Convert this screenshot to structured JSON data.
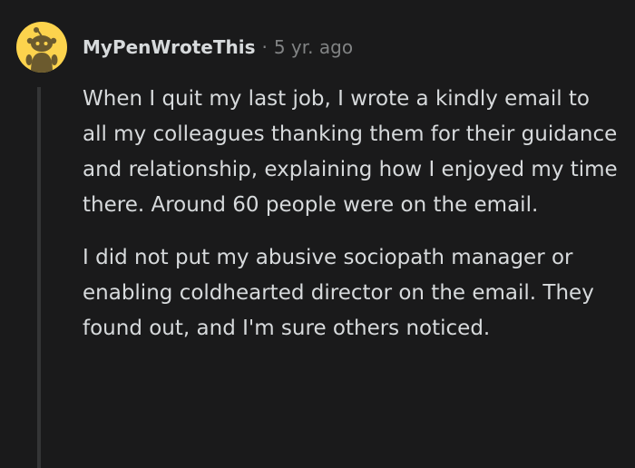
{
  "comment": {
    "author": "MyPenWroteThis",
    "separator": "·",
    "timestamp": "5 yr. ago",
    "paragraphs": [
      "When I quit my last job, I wrote a kindly email to all my colleagues thanking them for their guidance and relationship, explaining how I enjoyed my time there. Around 60 people were on the email.",
      "I did not put my abusive sociopath manager or enabling coldhearted director on the email. They found out, and I'm sure others noticed."
    ]
  },
  "colors": {
    "background": "#1a1a1b",
    "text": "#d7dadc",
    "muted": "#818384",
    "avatar_bg": "#fcd34d",
    "thread_line": "#343536"
  },
  "icons": {
    "avatar": "snoo-avatar-icon"
  }
}
